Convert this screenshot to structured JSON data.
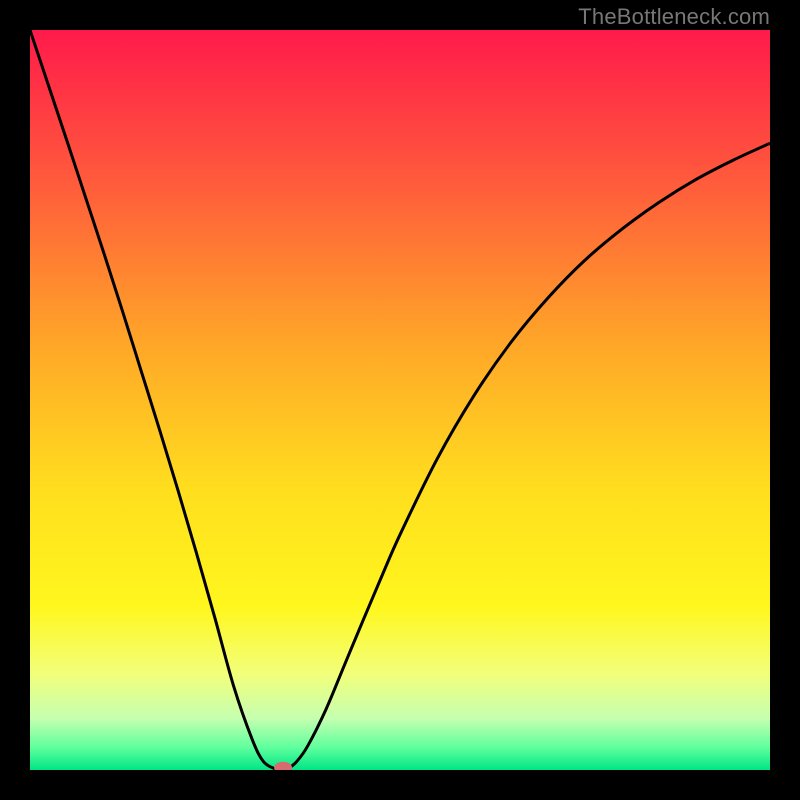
{
  "watermark": "TheBottleneck.com",
  "chart_data": {
    "type": "line",
    "title": "",
    "xlabel": "",
    "ylabel": "",
    "xlim": [
      0,
      100
    ],
    "ylim": [
      0,
      100
    ],
    "grid": false,
    "legend": false,
    "background_gradient": {
      "stops": [
        {
          "offset": 0.0,
          "color": "#ff1a4b"
        },
        {
          "offset": 0.2,
          "color": "#ff593c"
        },
        {
          "offset": 0.42,
          "color": "#ffa528"
        },
        {
          "offset": 0.62,
          "color": "#ffde1e"
        },
        {
          "offset": 0.78,
          "color": "#fff71e"
        },
        {
          "offset": 0.87,
          "color": "#f2ff7a"
        },
        {
          "offset": 0.93,
          "color": "#c6ffb0"
        },
        {
          "offset": 0.97,
          "color": "#5eff9d"
        },
        {
          "offset": 1.0,
          "color": "#00e585"
        }
      ]
    },
    "series": [
      {
        "name": "bottleneck-curve",
        "x": [
          0.0,
          2.5,
          5.0,
          7.5,
          10.0,
          12.5,
          15.0,
          17.5,
          20.0,
          22.5,
          25.0,
          27.5,
          30.0,
          31.5,
          33.0,
          34.0,
          35.0,
          36.0,
          37.5,
          40.0,
          42.5,
          45.0,
          47.5,
          50.0,
          55.0,
          60.0,
          65.0,
          70.0,
          75.0,
          80.0,
          85.0,
          90.0,
          95.0,
          100.0
        ],
        "y": [
          100.0,
          92.5,
          85.0,
          77.4,
          69.8,
          62.0,
          54.0,
          46.0,
          37.8,
          29.3,
          20.5,
          11.4,
          4.2,
          1.2,
          0.2,
          0.05,
          0.3,
          1.1,
          3.2,
          8.2,
          14.2,
          20.2,
          26.1,
          31.8,
          42.0,
          50.6,
          57.8,
          63.8,
          68.9,
          73.1,
          76.7,
          79.8,
          82.4,
          84.7
        ]
      }
    ],
    "marker": {
      "x": 34.2,
      "y": 0.3,
      "color": "#d96a6f",
      "rx": 9,
      "ry": 6
    }
  }
}
